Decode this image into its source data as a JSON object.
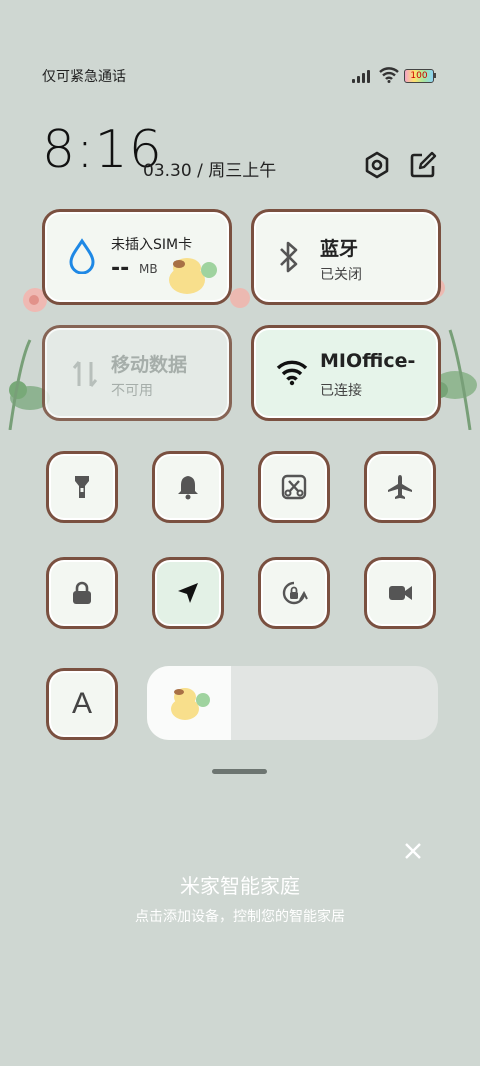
{
  "status": {
    "left_text": "仅可紧急通话",
    "battery": "100"
  },
  "clock": {
    "time": "8:16",
    "date": "03.30 / 周三上午"
  },
  "tiles": {
    "sim": {
      "title": "未插入SIM卡",
      "value": "--",
      "unit": "MB"
    },
    "bluetooth": {
      "title": "蓝牙",
      "subtitle": "已关闭"
    },
    "mobile_data": {
      "title": "移动数据",
      "subtitle": "不可用"
    },
    "wifi": {
      "title": "MIOffice-",
      "subtitle": "已连接"
    }
  },
  "toggles": [
    "flashlight-icon",
    "bell-icon",
    "screenshot-icon",
    "airplane-icon",
    "lock-icon",
    "location-icon",
    "rotation-lock-icon",
    "video-icon",
    "font-icon"
  ],
  "font_label": "A",
  "brightness": {
    "level": 0.29
  },
  "home": {
    "title": "米家智能家庭",
    "subtitle": "点击添加设备，控制您的智能家居"
  },
  "colors": {
    "background": "#cfd7d2",
    "border": "#7a5040",
    "tile": "#f3f7f2"
  }
}
